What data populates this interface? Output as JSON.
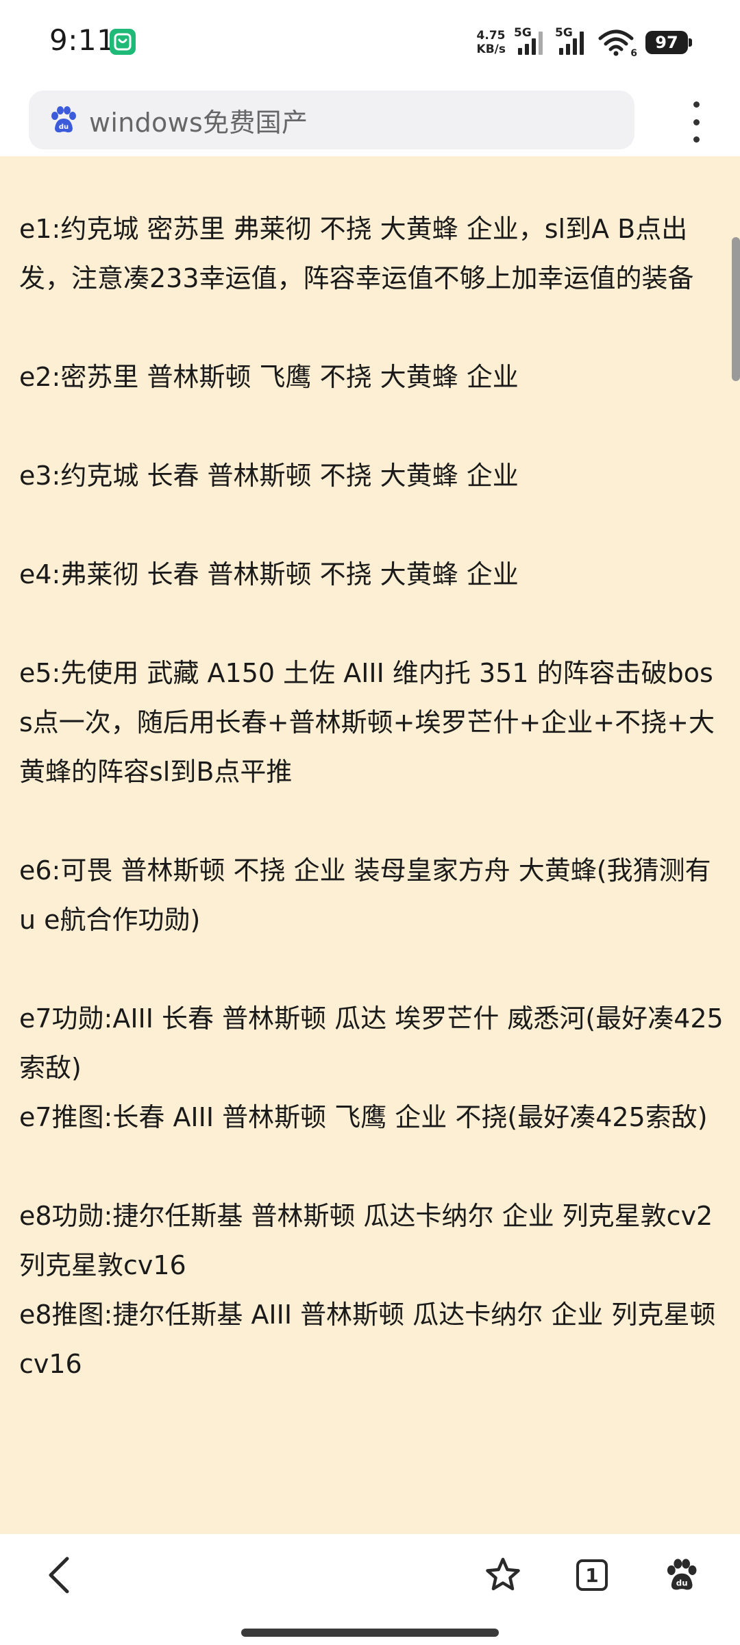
{
  "status_bar": {
    "time": "9:11",
    "net_speed_value": "4.75",
    "net_speed_unit": "KB/s",
    "network1": "5G",
    "network2": "5G",
    "wifi_label": "6",
    "battery": "97"
  },
  "search": {
    "query": "windows免费国产",
    "icon": "baidu-paw-icon"
  },
  "content": {
    "paragraphs": [
      "e1:约克城 密苏里 弗莱彻 不挠 大黄蜂 企业，sl到A B点出发，注意凑233幸运值，阵容幸运值不够上加幸运值的装备",
      "e2:密苏里 普林斯顿 飞鹰 不挠 大黄蜂 企业",
      "e3:约克城 长春 普林斯顿 不挠 大黄蜂 企业",
      "e4:弗莱彻 长春 普林斯顿 不挠 大黄蜂 企业",
      "e5:先使用 武藏 A150 土佐 AIII 维内托 351 的阵容击破boss点一次，随后用长春+普林斯顿+埃罗芒什+企业+不挠+大黄蜂的阵容sl到B点平推",
      "e6:可畏 普林斯顿 不挠 企业 装母皇家方舟 大黄蜂(我猜测有u e航合作功勋)",
      "e7功勋:AIII 长春 普林斯顿 瓜达 埃罗芒什 威悉河(最好凑425索敌)",
      "e7推图:长春 AIII 普林斯顿 飞鹰 企业 不挠(最好凑425索敌)",
      "e8功勋:捷尔任斯基 普林斯顿 瓜达卡纳尔 企业 列克星敦cv2 列克星敦cv16",
      "e8推图:捷尔任斯基 AIII 普林斯顿 瓜达卡纳尔 企业 列克星顿cv16"
    ]
  },
  "bottom_bar": {
    "tab_count": "1",
    "icons": [
      "back-arrow-icon",
      "star-icon",
      "tabs-icon",
      "baidu-paw-icon"
    ]
  },
  "colors": {
    "content_bg": "#fcefd3",
    "baidu_blue": "#3b5bdb",
    "mi_green": "#1fb978"
  }
}
